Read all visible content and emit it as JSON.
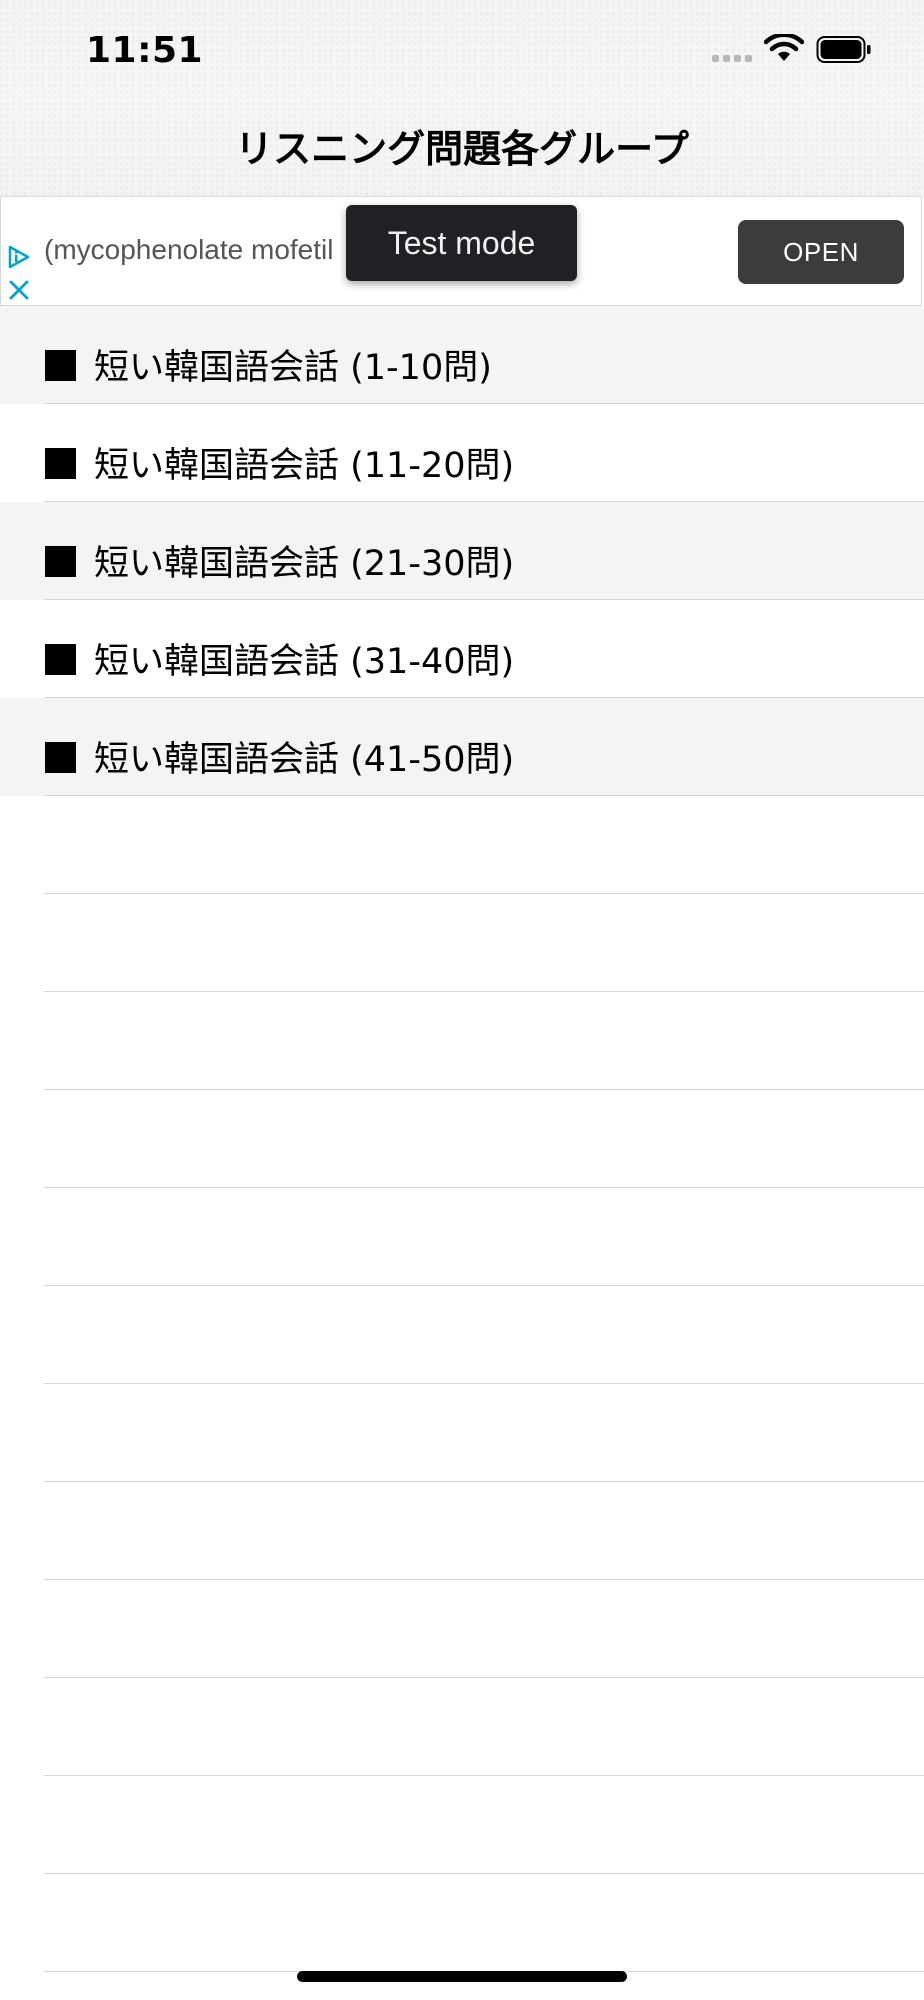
{
  "status_bar": {
    "time": "11:51"
  },
  "nav": {
    "title": "リスニング問題各グループ"
  },
  "ad": {
    "text": "(mycophenolate mofetil",
    "open_label": "OPEN",
    "test_mode_label": "Test mode",
    "accent_color": "#00a3d2"
  },
  "list": {
    "items": [
      {
        "label": "短い韓国語会話 (1-10問)"
      },
      {
        "label": "短い韓国語会話 (11-20問)"
      },
      {
        "label": "短い韓国語会話 (21-30問)"
      },
      {
        "label": "短い韓国語会話 (31-40問)"
      },
      {
        "label": "短い韓国語会話 (41-50問)"
      }
    ]
  }
}
